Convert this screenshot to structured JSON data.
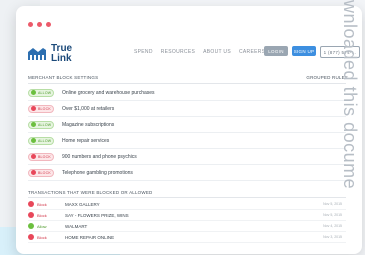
{
  "header": {
    "brand_line1": "True",
    "brand_line2": "Link",
    "nav": [
      "SPEND",
      "RESOURCES",
      "ABOUT US",
      "CAREERS"
    ],
    "login_label": "LOGIN",
    "signup_label": "SIGN UP",
    "phone_label": "1 (877) 574-..."
  },
  "rules_section": {
    "title": "MERCHANT BLOCK SETTINGS",
    "right_label": "GROUPED RULES",
    "rules": [
      {
        "status": "allow",
        "toggle_label": "ALLOW",
        "label": "Online grocery and warehouse purchases"
      },
      {
        "status": "block",
        "toggle_label": "BLOCK",
        "label": "Over $1,000 at retailers"
      },
      {
        "status": "allow",
        "toggle_label": "ALLOW",
        "label": "Magazine subscriptions"
      },
      {
        "status": "allow",
        "toggle_label": "ALLOW",
        "label": "Home repair services"
      },
      {
        "status": "block",
        "toggle_label": "BLOCK",
        "label": "900 numbers and phone psychics"
      },
      {
        "status": "block",
        "toggle_label": "BLOCK",
        "label": "Telephone gambling promotions"
      }
    ]
  },
  "log_section": {
    "title": "TRANSACTIONS THAT WERE BLOCKED OR ALLOWED",
    "rows": [
      {
        "status": "block",
        "status_label": "Block",
        "merchant": "MAXX GALLERY",
        "date": "Nov 5, 2015"
      },
      {
        "status": "block",
        "status_label": "Block",
        "merchant": "SAY - FLOWERS PRIZE, WINS",
        "date": "Nov 5, 2015"
      },
      {
        "status": "allow",
        "status_label": "Allow",
        "merchant": "WALMART",
        "date": "Nov 4, 2015"
      },
      {
        "status": "block",
        "status_label": "Block",
        "merchant": "HOME REPAIR ONLINE",
        "date": "Nov 3, 2015"
      }
    ]
  },
  "watermark": "wnloaded this docume",
  "colors": {
    "accent": "#3d8fe0",
    "allow": "#6cbf3f",
    "block": "#e8475a",
    "window_dot": "#ec5a6a"
  }
}
